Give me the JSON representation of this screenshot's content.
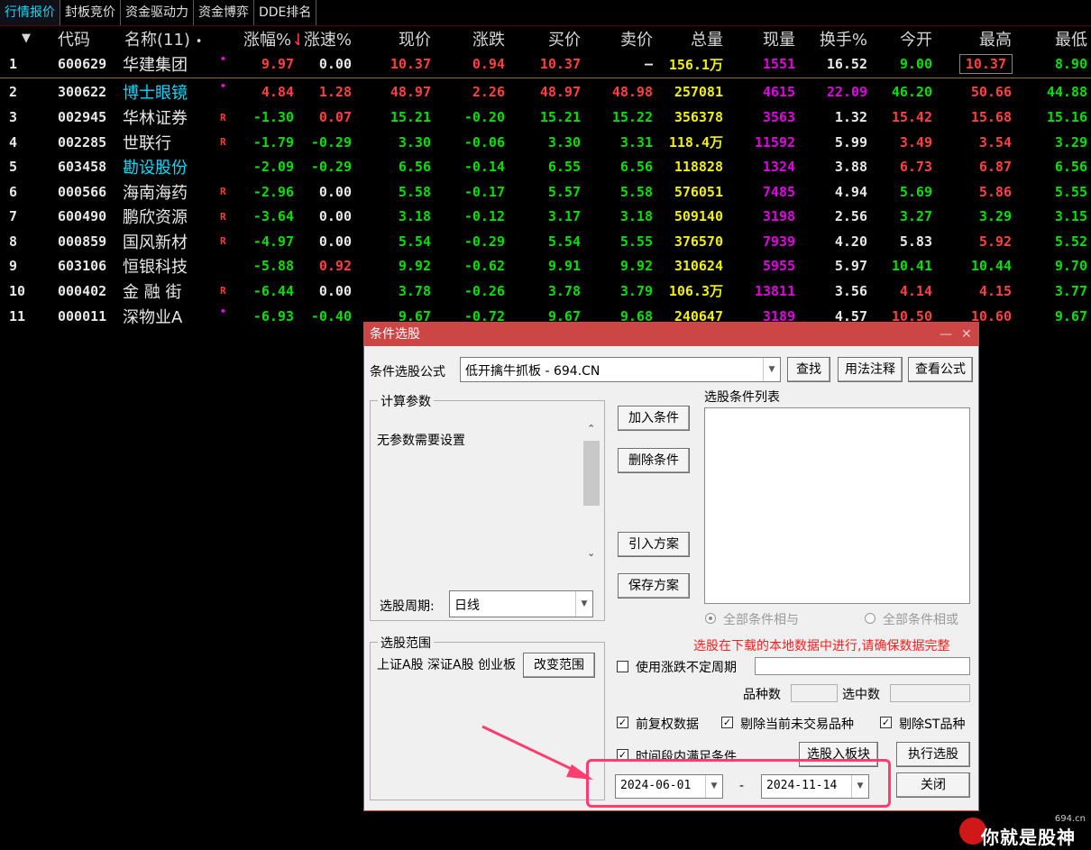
{
  "tabs": [
    "行情报价",
    "封板竞价",
    "资金驱动力",
    "资金博弈",
    "DDE排名"
  ],
  "columns": {
    "sort_icon": "▼",
    "code": "代码",
    "name": "名称(11)",
    "name_dot": "•",
    "pct": "涨幅%",
    "pct_arrow": "↓",
    "speed": "涨速%",
    "price": "现价",
    "change": "涨跌",
    "bid": "买价",
    "ask": "卖价",
    "volume": "总量",
    "cur_vol": "现量",
    "turnover": "换手%",
    "open": "今开",
    "high": "最高",
    "low": "最低"
  },
  "rows": [
    {
      "num": "1",
      "code": "600629",
      "name": "华建集团",
      "mark": "•",
      "pct": "9.97",
      "speed": "0.00",
      "price": "10.37",
      "change": "0.94",
      "bid": "10.37",
      "ask": "–",
      "volume": "156.1万",
      "cur_vol": "1551",
      "turnover": "16.52",
      "open": "9.00",
      "high": "10.37",
      "low": "8.90"
    },
    {
      "num": "2",
      "code": "300622",
      "name": "博士眼镜",
      "mark": "•",
      "pct": "4.84",
      "speed": "1.28",
      "price": "48.97",
      "change": "2.26",
      "bid": "48.97",
      "ask": "48.98",
      "volume": "257081",
      "cur_vol": "4615",
      "turnover": "22.09",
      "open": "46.20",
      "high": "50.66",
      "low": "44.88"
    },
    {
      "num": "3",
      "code": "002945",
      "name": "华林证券",
      "mark": "R",
      "pct": "-1.30",
      "speed": "0.07",
      "price": "15.21",
      "change": "-0.20",
      "bid": "15.21",
      "ask": "15.22",
      "volume": "356378",
      "cur_vol": "3563",
      "turnover": "1.32",
      "open": "15.42",
      "high": "15.68",
      "low": "15.16"
    },
    {
      "num": "4",
      "code": "002285",
      "name": "世联行",
      "mark": "R",
      "pct": "-1.79",
      "speed": "-0.29",
      "price": "3.30",
      "change": "-0.06",
      "bid": "3.30",
      "ask": "3.31",
      "volume": "118.4万",
      "cur_vol": "11592",
      "turnover": "5.99",
      "open": "3.49",
      "high": "3.54",
      "low": "3.29"
    },
    {
      "num": "5",
      "code": "603458",
      "name": "勘设股份",
      "mark": "",
      "pct": "-2.09",
      "speed": "-0.29",
      "price": "6.56",
      "change": "-0.14",
      "bid": "6.55",
      "ask": "6.56",
      "volume": "118828",
      "cur_vol": "1324",
      "turnover": "3.88",
      "open": "6.73",
      "high": "6.87",
      "low": "6.56"
    },
    {
      "num": "6",
      "code": "000566",
      "name": "海南海药",
      "mark": "R",
      "pct": "-2.96",
      "speed": "0.00",
      "price": "5.58",
      "change": "-0.17",
      "bid": "5.57",
      "ask": "5.58",
      "volume": "576051",
      "cur_vol": "7485",
      "turnover": "4.94",
      "open": "5.69",
      "high": "5.86",
      "low": "5.55"
    },
    {
      "num": "7",
      "code": "600490",
      "name": "鹏欣资源",
      "mark": "R",
      "pct": "-3.64",
      "speed": "0.00",
      "price": "3.18",
      "change": "-0.12",
      "bid": "3.17",
      "ask": "3.18",
      "volume": "509140",
      "cur_vol": "3198",
      "turnover": "2.56",
      "open": "3.27",
      "high": "3.29",
      "low": "3.15"
    },
    {
      "num": "8",
      "code": "000859",
      "name": "国风新材",
      "mark": "R",
      "pct": "-4.97",
      "speed": "0.00",
      "price": "5.54",
      "change": "-0.29",
      "bid": "5.54",
      "ask": "5.55",
      "volume": "376570",
      "cur_vol": "7939",
      "turnover": "4.20",
      "open": "5.83",
      "high": "5.92",
      "low": "5.52"
    },
    {
      "num": "9",
      "code": "603106",
      "name": "恒银科技",
      "mark": "",
      "pct": "-5.88",
      "speed": "0.92",
      "price": "9.92",
      "change": "-0.62",
      "bid": "9.91",
      "ask": "9.92",
      "volume": "310624",
      "cur_vol": "5955",
      "turnover": "5.97",
      "open": "10.41",
      "high": "10.44",
      "low": "9.70"
    },
    {
      "num": "10",
      "code": "000402",
      "name": "金 融 街",
      "mark": "R",
      "pct": "-6.44",
      "speed": "0.00",
      "price": "3.78",
      "change": "-0.26",
      "bid": "3.78",
      "ask": "3.79",
      "volume": "106.3万",
      "cur_vol": "13811",
      "turnover": "3.56",
      "open": "4.14",
      "high": "4.15",
      "low": "3.77"
    },
    {
      "num": "11",
      "code": "000011",
      "name": "深物业A",
      "mark": "•",
      "pct": "-6.93",
      "speed": "-0.40",
      "price": "9.67",
      "change": "-0.72",
      "bid": "9.67",
      "ask": "9.68",
      "volume": "240647",
      "cur_vol": "3189",
      "turnover": "4.57",
      "open": "10.50",
      "high": "10.60",
      "low": "9.67"
    }
  ],
  "dialog": {
    "title": "条件选股",
    "minimize": "—",
    "close_x": "✕",
    "formula_label": "条件选股公式",
    "formula_value": "低开擒牛抓板  -  694.CN",
    "find_btn": "查找",
    "usage_btn": "用法注释",
    "view_btn": "查看公式",
    "params_group": "计算参数",
    "params_text": "无参数需要设置",
    "period_label": "选股周期:",
    "period_value": "日线",
    "list_label": "选股条件列表",
    "add_btn": "加入条件",
    "del_btn": "删除条件",
    "import_btn": "引入方案",
    "save_btn": "保存方案",
    "radio_and": "全部条件相与",
    "radio_or": "全部条件相或",
    "warning": "选股在下载的本地数据中进行,请确保数据完整",
    "range_group": "选股范围",
    "range_text": "上证A股 深证A股 创业板",
    "change_range_btn": "改变范围",
    "use_uncertain": "使用涨跌不定周期",
    "count_label": "品种数",
    "selected_label": "选中数",
    "chk_adjust": "前复权数据",
    "chk_exclude_untraded": "剔除当前未交易品种",
    "chk_exclude_st": "剔除ST品种",
    "chk_period": "时间段内满足条件",
    "to_block_btn": "选股入板块",
    "execute_btn": "执行选股",
    "date_start": "2024-06-01",
    "date_sep": "-",
    "date_end": "2024-11-14",
    "close_btn": "关闭"
  },
  "watermark": {
    "site": "694.cn",
    "brand": "你就是股神"
  },
  "colors": {
    "up": "#ff4040",
    "down": "#00e000",
    "volume": "#f0f000",
    "cur_vol": "#e000e0",
    "dialog_title": "#cc4646",
    "highlight": "#ff3d6e"
  }
}
